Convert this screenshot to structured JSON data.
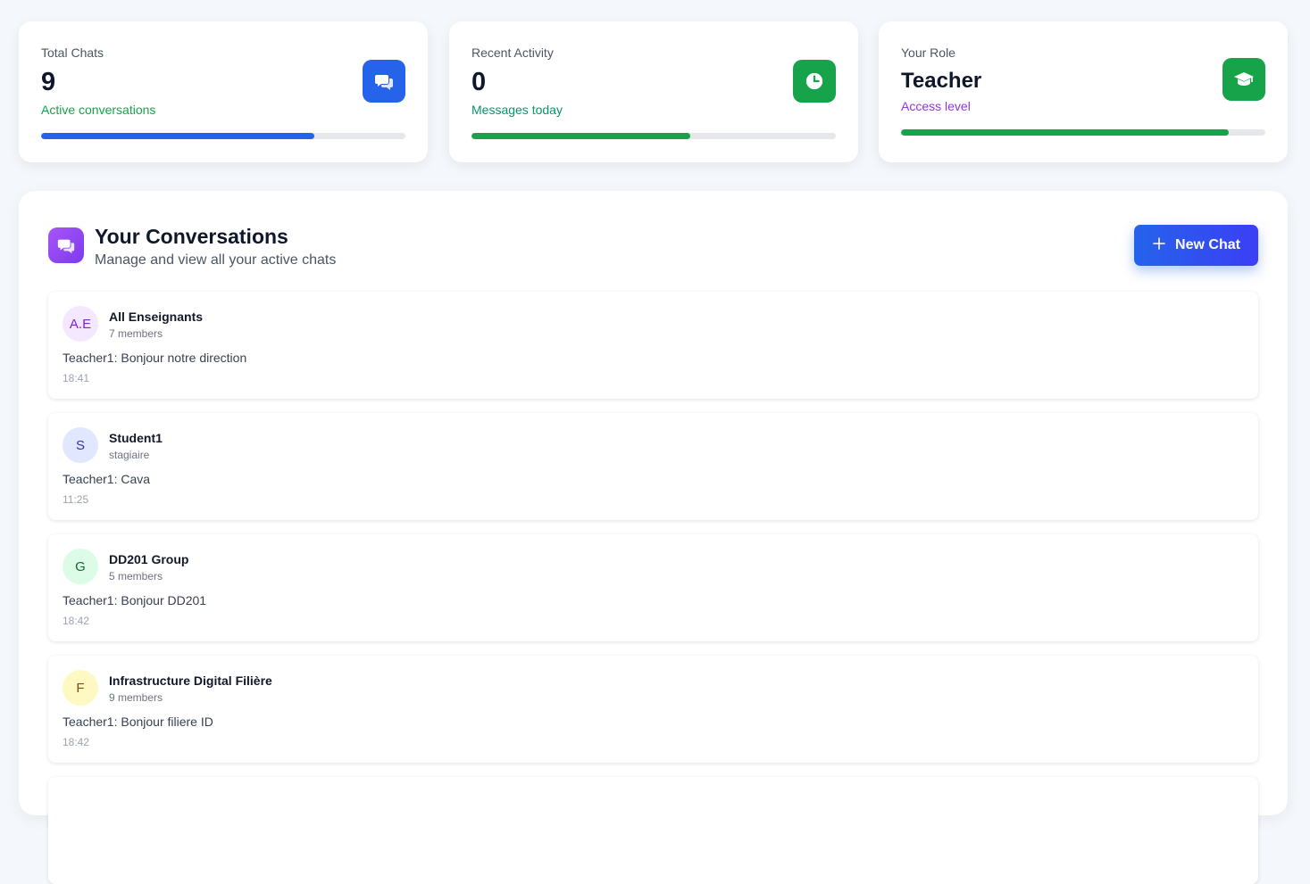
{
  "stats": [
    {
      "label": "Total Chats",
      "value": "9",
      "sub": "Active conversations",
      "sub_color": "#16a34a",
      "icon": "chat-bubbles-icon",
      "icon_bg": "#2563eb",
      "progress": 0.75,
      "bar_color": "#2563eb"
    },
    {
      "label": "Recent Activity",
      "value": "0",
      "sub": "Messages today",
      "sub_color": "#059669",
      "icon": "clock-icon",
      "icon_bg": "#16a34a",
      "progress": 0.6,
      "bar_color": "#16a34a"
    },
    {
      "label": "Your Role",
      "value": "Teacher",
      "sub": "Access level",
      "sub_color": "#9333ea",
      "icon": "graduation-cap-icon",
      "icon_bg": "#16a34a",
      "progress": 0.9,
      "bar_color": "#16a34a"
    }
  ],
  "conversations_panel": {
    "title": "Your Conversations",
    "subtitle": "Manage and view all your active chats",
    "icon": "chat-bubbles-icon",
    "new_chat_label": "New Chat",
    "new_chat_icon": "plus-icon"
  },
  "conversations": [
    {
      "initials": "A.E",
      "name": "All Enseignants",
      "meta": "7 members",
      "last_message": "Teacher1: Bonjour notre direction",
      "time": "18:41",
      "avatar_bg": "#f3e8ff",
      "avatar_color": "#7e22ce"
    },
    {
      "initials": "S",
      "name": "Student1",
      "meta": "stagiaire",
      "last_message": "Teacher1: Cava",
      "time": "11:25",
      "avatar_bg": "#e0e7ff",
      "avatar_color": "#3730a3"
    },
    {
      "initials": "G",
      "name": "DD201 Group",
      "meta": "5 members",
      "last_message": "Teacher1: Bonjour DD201",
      "time": "18:42",
      "avatar_bg": "#dcfce7",
      "avatar_color": "#166534"
    },
    {
      "initials": "F",
      "name": "Infrastructure Digital Filière",
      "meta": "9 members",
      "last_message": "Teacher1: Bonjour filiere ID",
      "time": "18:42",
      "avatar_bg": "#fef9c3",
      "avatar_color": "#854d0e"
    }
  ]
}
